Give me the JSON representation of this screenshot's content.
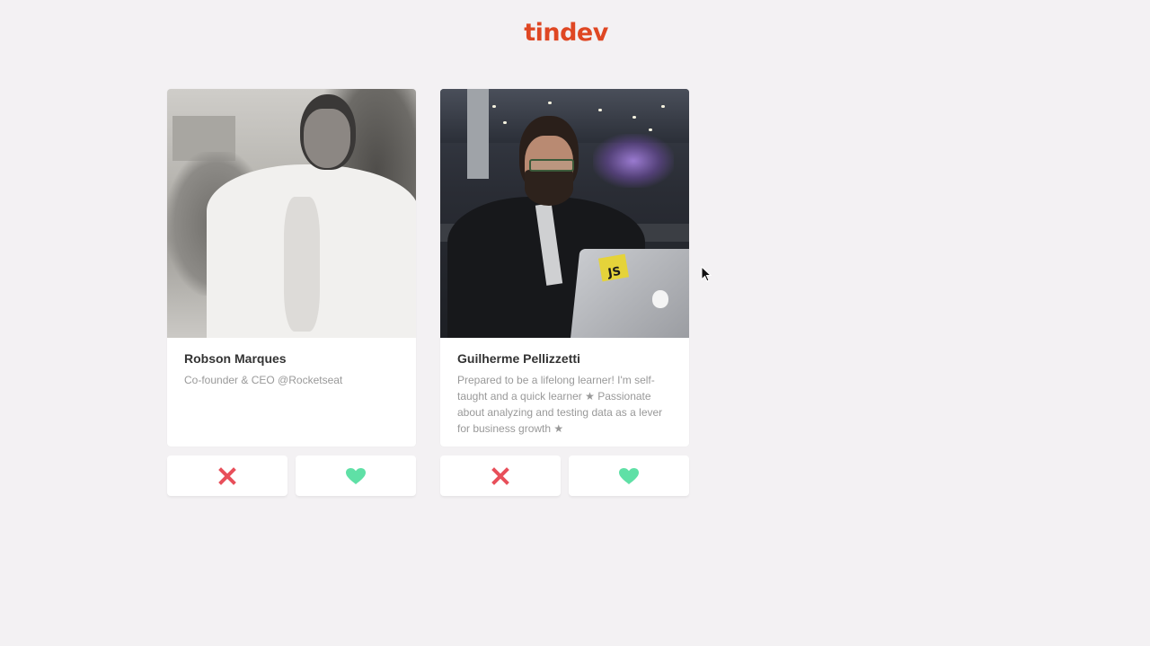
{
  "brand": {
    "logo_text": "tindev",
    "logo_color": "#df4723"
  },
  "colors": {
    "dislike": "#e84f5a",
    "like": "#5fe0a6",
    "background": "#f3f1f3",
    "name_text": "#333333",
    "bio_text": "#999999"
  },
  "developers": [
    {
      "name": "Robson Marques",
      "bio": "Co-founder & CEO @Rocketseat",
      "avatar_icon": "user-photo",
      "dislike_icon": "x-icon",
      "like_icon": "heart-icon"
    },
    {
      "name": "Guilherme Pellizzetti",
      "bio": "Prepared to be a lifelong learner! I'm self-taught and a quick learner ★ Passionate about analyzing and testing data as a lever for business growth ★",
      "avatar_icon": "user-photo",
      "sticker_text": "JS",
      "dislike_icon": "x-icon",
      "like_icon": "heart-icon"
    }
  ]
}
